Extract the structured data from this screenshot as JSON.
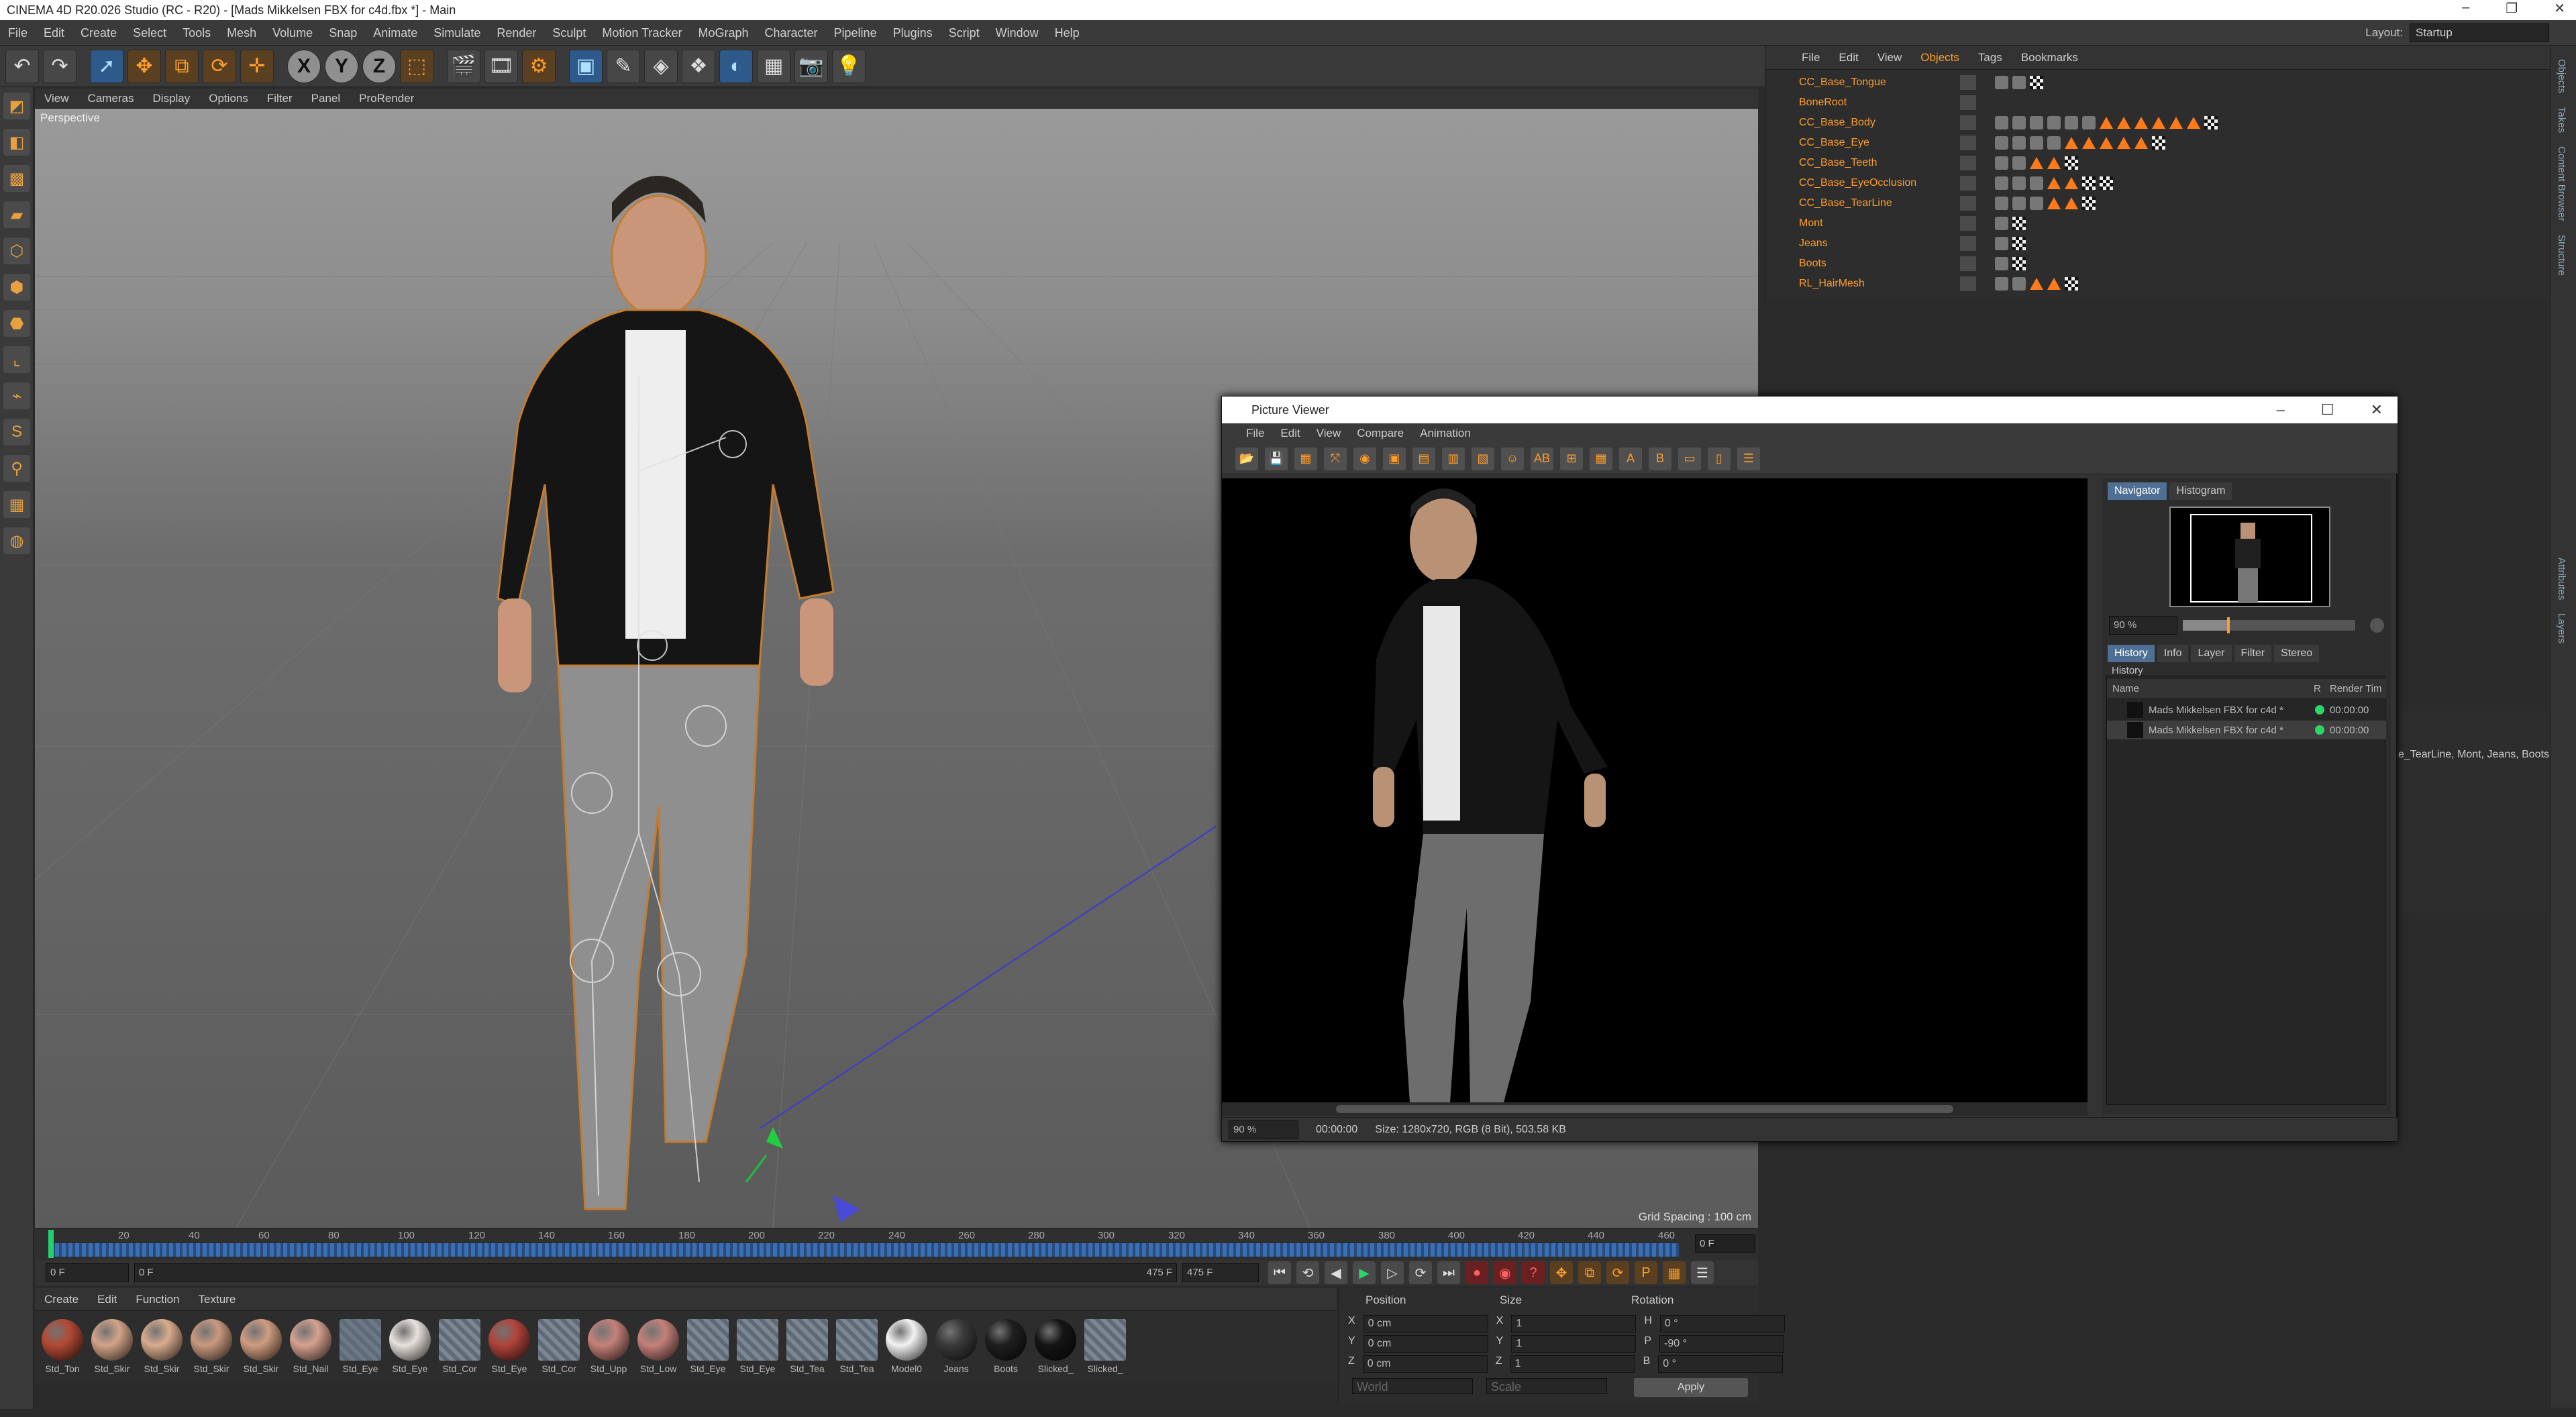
{
  "window": {
    "title": "CINEMA 4D R20.026 Studio (RC - R20) - [Mads Mikkelsen FBX for c4d.fbx *] - Main"
  },
  "main_menu": [
    "File",
    "Edit",
    "Create",
    "Select",
    "Tools",
    "Mesh",
    "Volume",
    "Snap",
    "Animate",
    "Simulate",
    "Render",
    "Sculpt",
    "Motion Tracker",
    "MoGraph",
    "Character",
    "Pipeline",
    "Plugins",
    "Script",
    "Window",
    "Help"
  ],
  "layout": {
    "label": "Layout:",
    "value": "Startup"
  },
  "viewport": {
    "menu": [
      "View",
      "Cameras",
      "Display",
      "Options",
      "Filter",
      "Panel",
      "ProRender"
    ],
    "label": "Perspective",
    "grid_spacing": "Grid Spacing : 100 cm"
  },
  "timeline": {
    "ticks": [
      "0",
      "20",
      "40",
      "60",
      "80",
      "100",
      "120",
      "140",
      "160",
      "180",
      "200",
      "220",
      "240",
      "260",
      "280",
      "300",
      "320",
      "340",
      "360",
      "380",
      "400",
      "420",
      "440",
      "460"
    ],
    "current_frame": "0 F",
    "start": "0 F",
    "range_start": "0 F",
    "range_end": "475 F",
    "end": "475 F"
  },
  "materials": {
    "menu": [
      "Create",
      "Edit",
      "Function",
      "Texture"
    ],
    "items": [
      {
        "name": "Std_Ton",
        "color": "#b24a35",
        "kind": "ball"
      },
      {
        "name": "Std_Skir",
        "color": "#d3a488",
        "kind": "ball"
      },
      {
        "name": "Std_Skir",
        "color": "#d9ac8e",
        "kind": "ball"
      },
      {
        "name": "Std_Skir",
        "color": "#c99a7e",
        "kind": "ball"
      },
      {
        "name": "Std_Skir",
        "color": "#cf9d80",
        "kind": "ball"
      },
      {
        "name": "Std_Nail",
        "color": "#d6a190",
        "kind": "ball"
      },
      {
        "name": "Std_Eye",
        "color": "#6b7a8a",
        "kind": "flat"
      },
      {
        "name": "Std_Eye",
        "color": "#e8e2dc",
        "kind": "ball"
      },
      {
        "name": "Std_Cor",
        "color": "#7b8794",
        "kind": "flat"
      },
      {
        "name": "Std_Eye",
        "color": "#b0443a",
        "kind": "ball"
      },
      {
        "name": "Std_Cor",
        "color": "#7b8794",
        "kind": "flat"
      },
      {
        "name": "Std_Upp",
        "color": "#c5817a",
        "kind": "ball"
      },
      {
        "name": "Std_Low",
        "color": "#c5817a",
        "kind": "ball"
      },
      {
        "name": "Std_Eye",
        "color": "#7b8794",
        "kind": "flat"
      },
      {
        "name": "Std_Eye",
        "color": "#7b8794",
        "kind": "flat"
      },
      {
        "name": "Std_Tea",
        "color": "#7b8794",
        "kind": "flat"
      },
      {
        "name": "Std_Tea",
        "color": "#7b8794",
        "kind": "flat"
      },
      {
        "name": "Model0",
        "color": "#f2f2f2",
        "kind": "ball"
      },
      {
        "name": "Jeans",
        "color": "#3a3a3a",
        "kind": "ball"
      },
      {
        "name": "Boots",
        "color": "#1f1f1f",
        "kind": "ball"
      },
      {
        "name": "Slicked_",
        "color": "#151515",
        "kind": "ball"
      },
      {
        "name": "Slicked_",
        "color": "#7b8794",
        "kind": "flat"
      }
    ]
  },
  "coordinates": {
    "headers": [
      "Position",
      "Size",
      "Rotation"
    ],
    "rows": [
      {
        "axis": "X",
        "pos": "0 cm",
        "size_axis": "X",
        "size": "1",
        "rot_axis": "H",
        "rot": "0 °"
      },
      {
        "axis": "Y",
        "pos": "0 cm",
        "size_axis": "Y",
        "size": "1",
        "rot_axis": "P",
        "rot": "-90 °"
      },
      {
        "axis": "Z",
        "pos": "0 cm",
        "size_axis": "Z",
        "size": "1",
        "rot_axis": "B",
        "rot": "0 °"
      }
    ],
    "mode_world": "World",
    "mode_scale": "Scale",
    "apply": "Apply"
  },
  "object_manager": {
    "menu": [
      "File",
      "Edit",
      "View",
      "Objects",
      "Tags",
      "Bookmarks"
    ],
    "objects": [
      {
        "name": "CC_Base_Tongue",
        "tags": "sq,sq,ck"
      },
      {
        "name": "BoneRoot",
        "tags": ""
      },
      {
        "name": "CC_Base_Body",
        "tags": "sq,sq,sq,sq,sq,sq,tri,tri,tri,tri,tri,tri,ck"
      },
      {
        "name": "CC_Base_Eye",
        "tags": "sq,sq,sq,sq,tri,tri,tri,tri,tri,ck"
      },
      {
        "name": "CC_Base_Teeth",
        "tags": "sq,sq,tri,tri,ck"
      },
      {
        "name": "CC_Base_EyeOcclusion",
        "tags": "sq,sq,sq,tri,tri,ck,ck"
      },
      {
        "name": "CC_Base_TearLine",
        "tags": "sq,sq,sq,tri,tri,ck"
      },
      {
        "name": "Mont",
        "tags": "sq,ck"
      },
      {
        "name": "Jeans",
        "tags": "sq,ck"
      },
      {
        "name": "Boots",
        "tags": "sq,ck"
      },
      {
        "name": "RL_HairMesh",
        "tags": "sq,sq,tri,tri,ck"
      }
    ]
  },
  "side_tabs": [
    "Objects",
    "Takes",
    "Content Browser",
    "Structure",
    "Attributes",
    "Layers"
  ],
  "attributes": {
    "text": "e_TearLine, Mont, Jeans, Boots"
  },
  "picture_viewer": {
    "title": "Picture Viewer",
    "menu": [
      "File",
      "Edit",
      "View",
      "Compare",
      "Animation"
    ],
    "tabs_top": [
      "Navigator",
      "Histogram"
    ],
    "zoom": "90 %",
    "tabs_bottom": [
      "History",
      "Info",
      "Layer",
      "Filter",
      "Stereo"
    ],
    "history_label": "History",
    "columns": [
      "Name",
      "R",
      "Render Tim"
    ],
    "history": [
      {
        "name": "Mads Mikkelsen FBX for c4d *",
        "time": "00:00:00"
      },
      {
        "name": "Mads Mikkelsen FBX for c4d *",
        "time": "00:00:00"
      }
    ],
    "status": {
      "zoom": "90 %",
      "time": "00:00:00",
      "info": "Size: 1280x720, RGB (8 Bit), 503.58 KB"
    }
  }
}
